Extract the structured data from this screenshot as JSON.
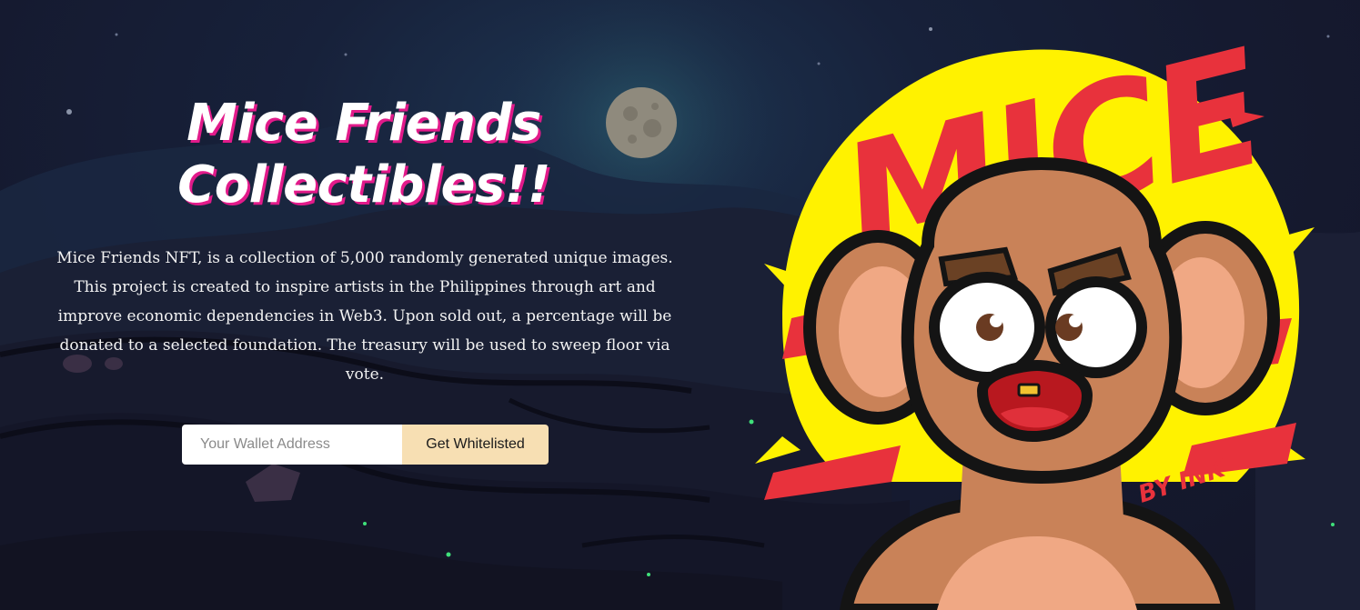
{
  "hero": {
    "title_line1": "Mice Friends",
    "title_line2": "Collectibles!!",
    "description": "Mice Friends NFT, is a collection of 5,000 randomly generated unique images. This project is created to inspire artists in the Philippines through art and improve economic dependencies in Web3. Upon sold out, a percentage will be donated to a selected foundation. The treasury will be used to sweep floor via vote."
  },
  "whitelist_form": {
    "placeholder": "Your Wallet Address",
    "button_label": "Get Whitelisted"
  },
  "mascot": {
    "logo_text": "MICE",
    "signature": "BY INK"
  },
  "colors": {
    "title_shadow": "#e21a8a",
    "button_bg": "#f7dfb3",
    "sun_yellow": "#fff200",
    "logo_red": "#e8323c",
    "fur": "#c98258",
    "ear_inner": "#f0a884"
  }
}
